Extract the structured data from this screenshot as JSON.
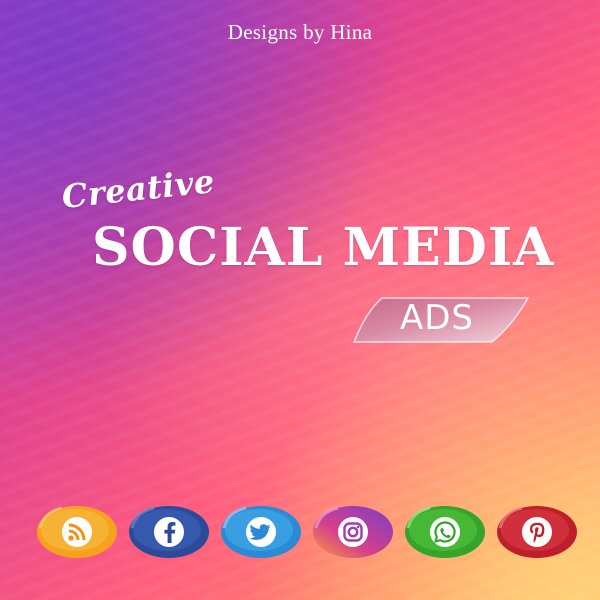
{
  "brand": "Designs by Hina",
  "headline": {
    "script": "Creative",
    "main": "SOCIAL MEDIA",
    "badge": "ADS"
  },
  "social_icons": [
    {
      "name": "rss-icon",
      "color": "#f59b1c"
    },
    {
      "name": "facebook-icon",
      "color": "#2f4fa0"
    },
    {
      "name": "twitter-icon",
      "color": "#2f8fd8"
    },
    {
      "name": "instagram-icon",
      "color": "#9b3fb0"
    },
    {
      "name": "whatsapp-icon",
      "color": "#3aa82c"
    },
    {
      "name": "pinterest-icon",
      "color": "#c0202a"
    }
  ]
}
